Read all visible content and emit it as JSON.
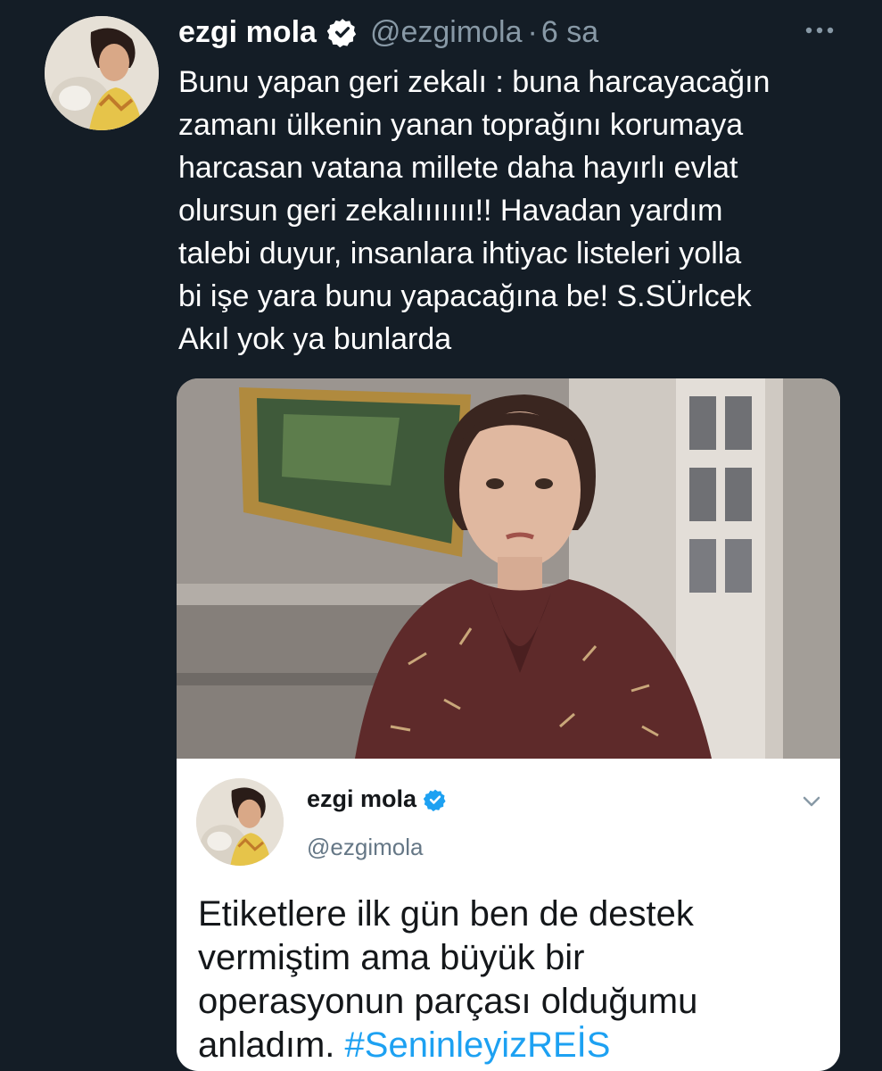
{
  "tweet": {
    "author_name": "ezgi mola",
    "handle": "@ezgimola",
    "separator": "·",
    "time": "6 sa",
    "text": "Bunu yapan geri zekalı : buna harcayacağın\nzamanı ülkenin yanan toprağını korumaya\nharcasan vatana millete daha hayırlı evlat\nolursun geri zekalııııııı!! Havadan yardım\ntalebi duyur, insanlara ihtiyac listeleri yolla\nbi işe yara bunu yapacağına be! S.SÜrlcek\nAkıl yok ya bunlarda",
    "more_icon": "more-horizontal-icon",
    "verified_icon": "verified-badge-icon"
  },
  "quoted_tweet": {
    "author_name": "ezgi mola",
    "handle": "@ezgimola",
    "text": "Etiketlere ilk gün ben de destek\nvermiştim ama büyük bir\noperasyonun parçası olduğumu\nanladım. ",
    "hashtag": "#SeninleyizREİS",
    "chevron_icon": "chevron-down-icon"
  },
  "colors": {
    "background": "#141d26",
    "secondary_text": "#8899a6",
    "accent": "#1da1f2"
  }
}
